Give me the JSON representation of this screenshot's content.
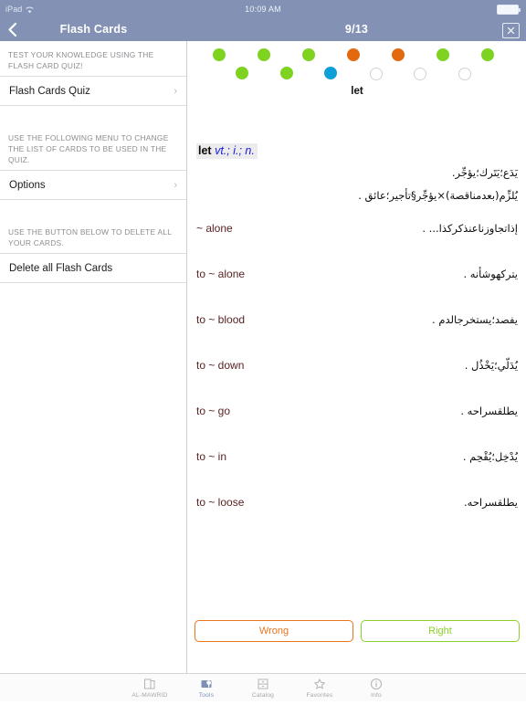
{
  "status_bar": {
    "device": "iPad",
    "wifi_icon": "wifi-icon",
    "time": "10:09 AM",
    "battery_icon": "battery-full-icon"
  },
  "sidebar": {
    "nav": {
      "back_icon": "back-chevron-icon",
      "title": "Flash Cards"
    },
    "sections": [
      {
        "header": "TEST YOUR KNOWLEDGE USING THE FLASH CARD QUIZ!",
        "rows": [
          {
            "label": "Flash Cards Quiz",
            "chevron": "chevron-right-icon"
          }
        ]
      },
      {
        "header": "USE THE FOLLOWING MENU TO CHANGE THE LIST OF CARDS TO BE USED IN THE QUIZ.",
        "rows": [
          {
            "label": "Options",
            "chevron": "chevron-right-icon"
          }
        ]
      },
      {
        "header": "USE THE BUTTON BELOW TO DELETE ALL YOUR CARDS.",
        "rows": [
          {
            "label": "Delete all Flash Cards",
            "chevron": ""
          }
        ]
      }
    ]
  },
  "quiz": {
    "nav": {
      "progress_label": "9/13",
      "close_icon": "close-x-icon"
    },
    "progress_dots": {
      "total": 13,
      "row1": [
        "correct",
        "correct",
        "correct",
        "wrong",
        "wrong",
        "correct",
        "correct"
      ],
      "row2": [
        "correct",
        "correct",
        "current",
        "pending",
        "pending",
        "pending"
      ],
      "colors": {
        "correct": "#7ed321",
        "wrong": "#e2690d",
        "current": "#0d9fd8",
        "pending": "#ffffff",
        "pending_border": "#d2d2d2"
      }
    },
    "cue_word": "let",
    "entry": {
      "headword": "let",
      "part_of_speech": "vt.; i.; n.",
      "senses": [
        "يَدَع؛يَتَرك؛يؤجِّر.",
        "يُلزِّم(بعدمناقصة)×يؤجِّر§تأجير؛عائق ."
      ]
    },
    "phrases": [
      {
        "en": "~ alone",
        "ar": "إذاتجاوزناعنذكركذا... ."
      },
      {
        "en": "to ~ alone",
        "ar": "يتركهوشأنه ."
      },
      {
        "en": "to ~ blood",
        "ar": "يفصد؛يستخرجالدم ."
      },
      {
        "en": "to ~ down",
        "ar": "يُدَلّي؛يَخْذُل ."
      },
      {
        "en": "to ~ go",
        "ar": "يطلقسراحه ."
      },
      {
        "en": "to ~ in",
        "ar": "يُدْخِل؛يُقْحِم ."
      },
      {
        "en": "to ~ loose",
        "ar": "يطلقسراحه."
      }
    ],
    "buttons": {
      "wrong_label": "Wrong",
      "right_label": "Right"
    }
  },
  "tabbar": {
    "selected": "Tools",
    "tabs": [
      {
        "label": "AL-MAWRID",
        "icon": "book-icon"
      },
      {
        "label": "Tools",
        "icon": "tools-icon"
      },
      {
        "label": "Catalog",
        "icon": "drawer-icon"
      },
      {
        "label": "Favorites",
        "icon": "star-icon"
      },
      {
        "label": "Info",
        "icon": "info-circle-icon"
      }
    ]
  },
  "theme": {
    "nav_bg": "#8392b4",
    "accent_wrong": "#e8741c",
    "accent_right": "#8ad22a",
    "term_color": "#5a2323",
    "pos_color": "#1417e0"
  }
}
